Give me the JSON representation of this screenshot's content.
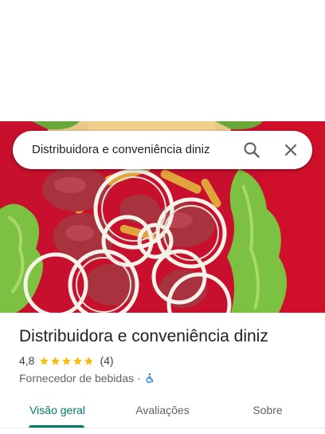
{
  "search": {
    "query": "Distribuidora e conveniência diniz",
    "search_icon": "search-icon",
    "close_icon": "close-icon"
  },
  "hero": {
    "image": "food-photo-sausage-onions-fries-lettuce"
  },
  "place": {
    "title": "Distribuidora e conveniência diniz",
    "rating": "4,8",
    "stars": 5,
    "review_count": "(4)",
    "category": "Fornecedor de bebidas",
    "separator": "·",
    "accessibility_icon": "wheelchair-icon"
  },
  "tabs": [
    {
      "label": "Visão geral",
      "active": true
    },
    {
      "label": "Avaliações",
      "active": false
    },
    {
      "label": "Sobre",
      "active": false
    }
  ],
  "colors": {
    "accent": "#00796b",
    "star": "#fbbc04",
    "accessibility": "#1a73e8"
  }
}
